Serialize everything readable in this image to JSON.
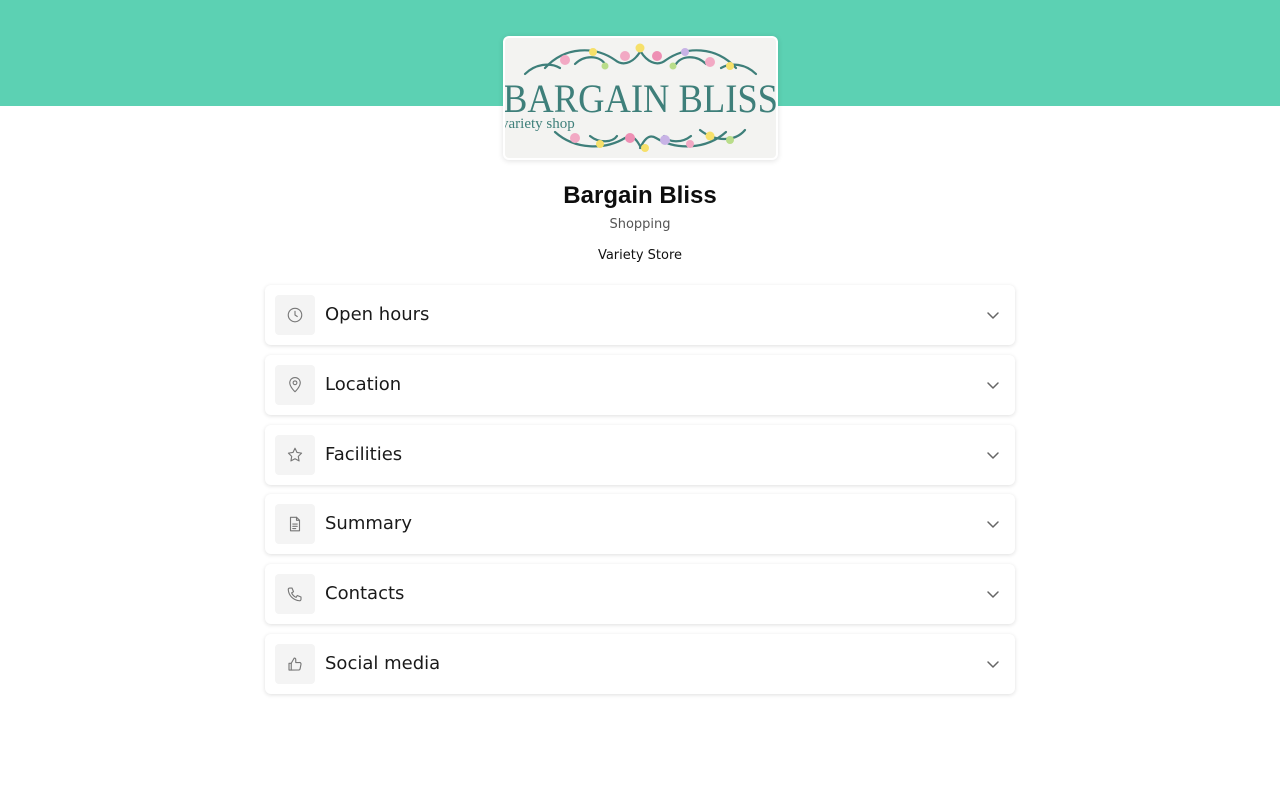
{
  "header": {
    "banner_color": "#5cd1b3",
    "logo": {
      "brand_text": "BARGAIN BLISS",
      "tagline": "variety shop",
      "text_color": "#3e7f7a"
    }
  },
  "business": {
    "name": "Bargain Bliss",
    "category": "Shopping",
    "subcategory": "Variety Store"
  },
  "sections": [
    {
      "label": "Open hours",
      "icon": "clock-icon"
    },
    {
      "label": "Location",
      "icon": "map-pin-icon"
    },
    {
      "label": "Facilities",
      "icon": "star-icon"
    },
    {
      "label": "Summary",
      "icon": "document-icon"
    },
    {
      "label": "Contacts",
      "icon": "phone-icon"
    },
    {
      "label": "Social media",
      "icon": "thumbs-up-icon"
    }
  ]
}
